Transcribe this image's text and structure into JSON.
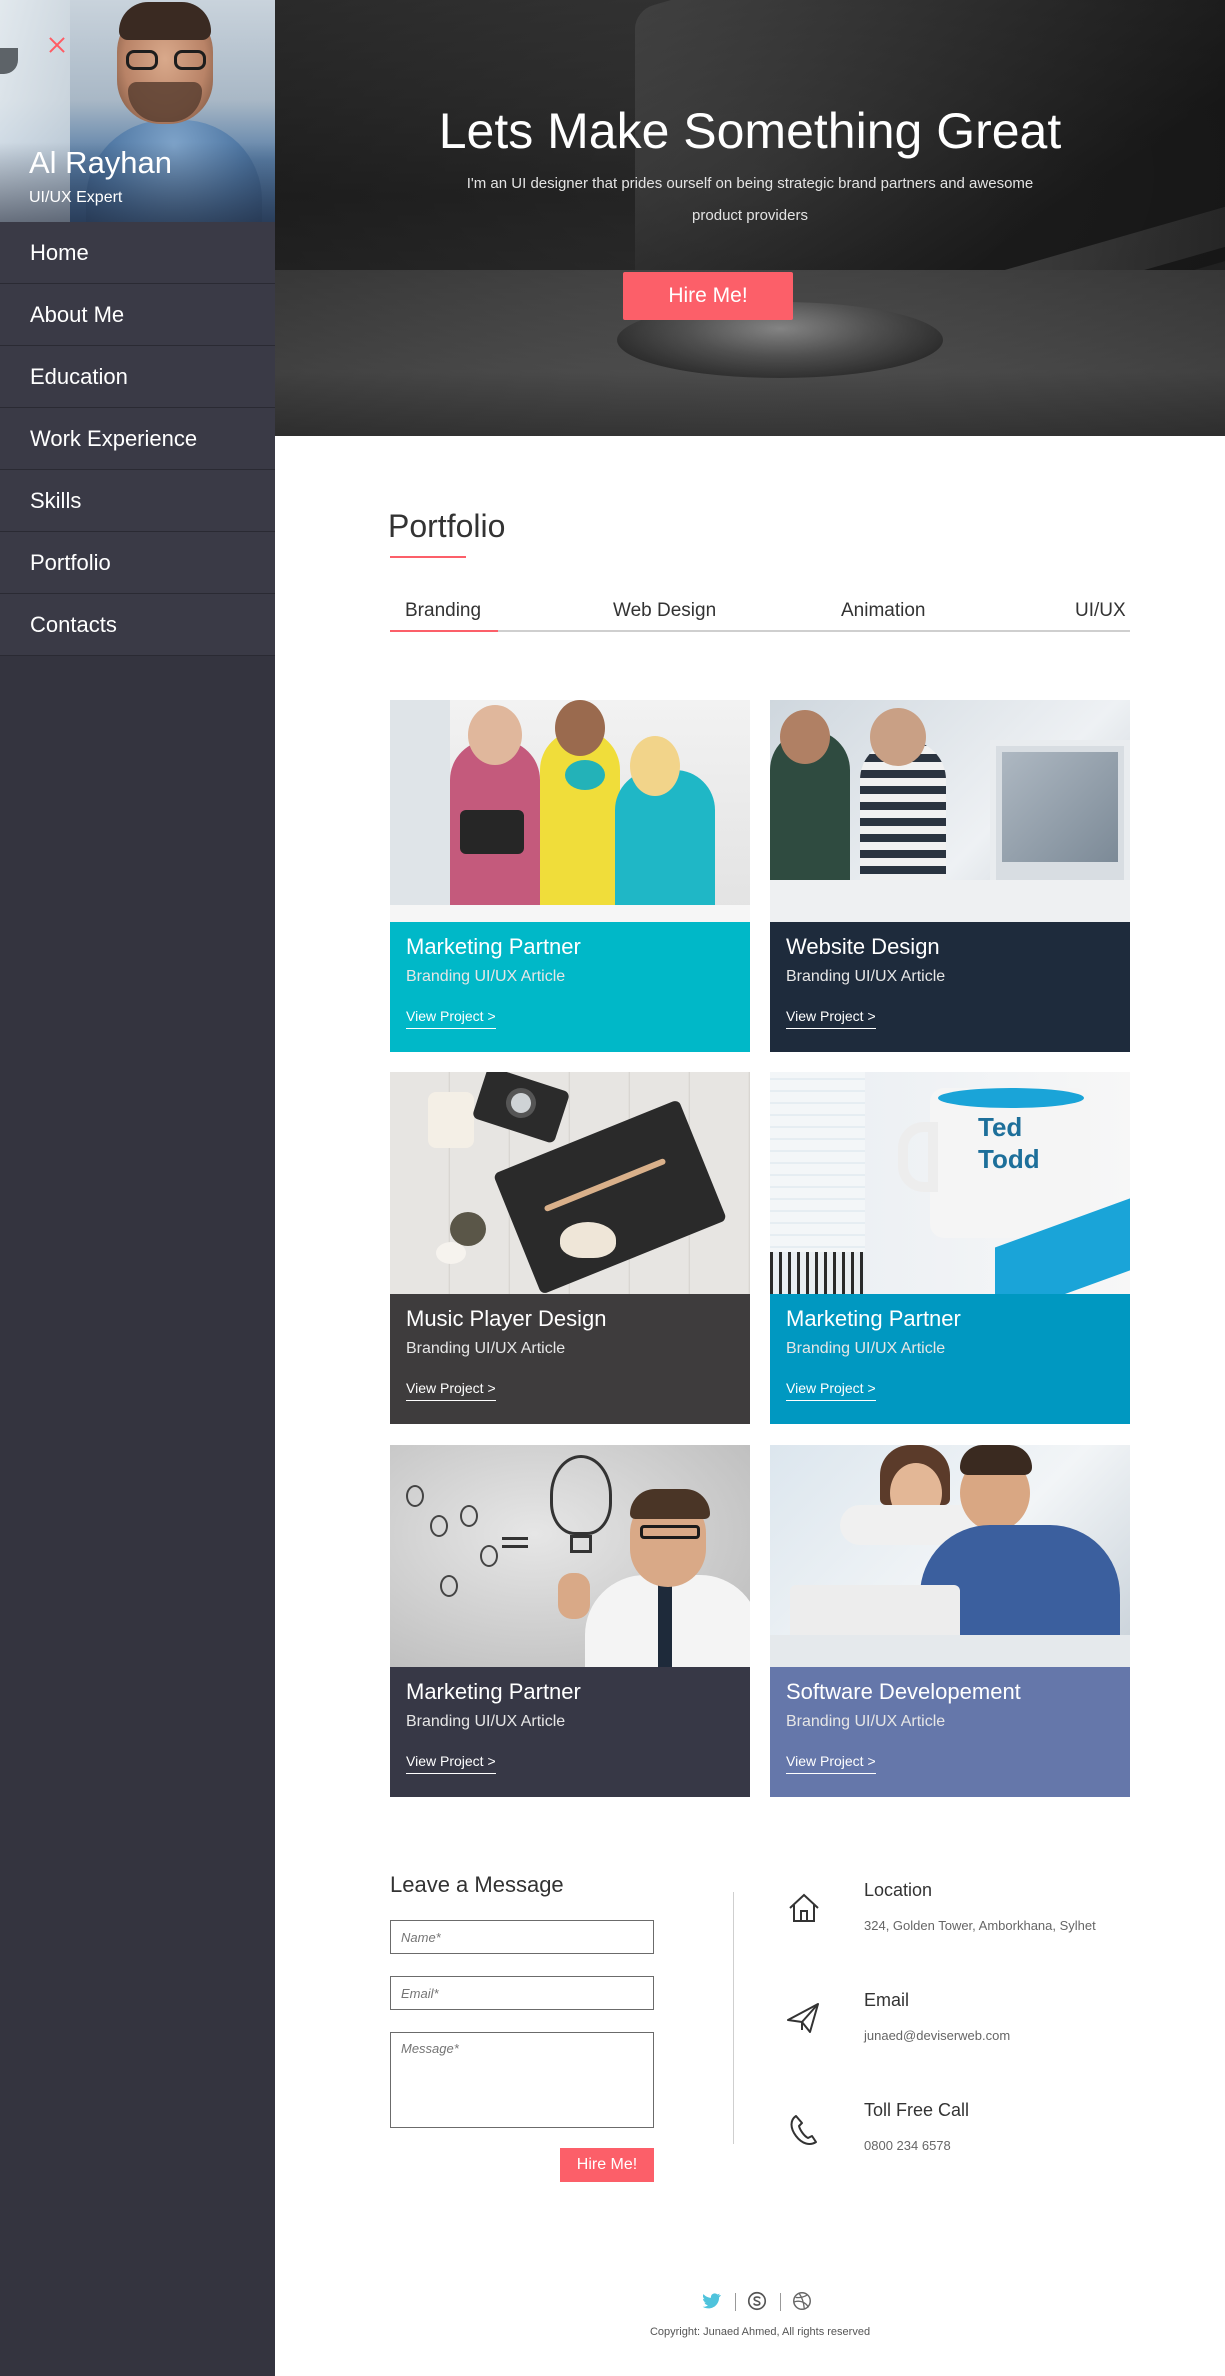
{
  "profile": {
    "name": "Al Rayhan",
    "role": "UI/UX Expert"
  },
  "nav": {
    "items": [
      {
        "label": "Home"
      },
      {
        "label": "About Me"
      },
      {
        "label": "Education"
      },
      {
        "label": "Work Experience"
      },
      {
        "label": "Skills"
      },
      {
        "label": "Portfolio"
      },
      {
        "label": "Contacts"
      }
    ]
  },
  "hero": {
    "title": "Lets Make Something Great",
    "subtitle": "I'm an UI designer that prides ourself on being strategic brand partners and awesome product providers",
    "cta": "Hire Me!"
  },
  "portfolio": {
    "title": "Portfolio",
    "tabs": [
      {
        "label": "Branding"
      },
      {
        "label": "Web Design"
      },
      {
        "label": "Animation"
      },
      {
        "label": "UI/UX"
      }
    ],
    "cards": [
      {
        "title": "Marketing Partner",
        "subtitle": "Branding UI/UX Article",
        "link": "View Project >",
        "color": "#00b8c8"
      },
      {
        "title": "Website Design",
        "subtitle": "Branding UI/UX Article",
        "link": "View Project >",
        "color": "#1e2b3c"
      },
      {
        "title": "Music Player Design",
        "subtitle": "Branding UI/UX Article",
        "link": "View Project >",
        "color": "#3e3c3d"
      },
      {
        "title": "Marketing Partner",
        "subtitle": "Branding UI/UX Article",
        "link": "View Project >",
        "color": "#0098c1"
      },
      {
        "title": "Marketing Partner",
        "subtitle": "Branding UI/UX Article",
        "link": "View Project >",
        "color": "#373846"
      },
      {
        "title": "Software Developement",
        "subtitle": "Branding UI/UX Article",
        "link": "View Project >",
        "color": "#6577aa"
      }
    ]
  },
  "contact": {
    "title": "Leave a Message",
    "name_placeholder": "Name*",
    "email_placeholder": "Email*",
    "message_placeholder": "Message*",
    "submit": "Hire Me!",
    "location_label": "Location",
    "location_value": "324, Golden Tower, Amborkhana, Sylhet",
    "email_label": "Email",
    "email_value": "junaed@deviserweb.com",
    "phone_label": "Toll Free Call",
    "phone_value": "0800 234 6578"
  },
  "footer": {
    "copyright": "Copyright: Junaed Ahmed, All rights reserved",
    "icons": [
      "twitter-icon",
      "skype-icon",
      "dribbble-icon"
    ]
  },
  "colors": {
    "accent": "#fc5f69",
    "sidebar": "#34343f",
    "twitter": "#4fc3dc"
  }
}
